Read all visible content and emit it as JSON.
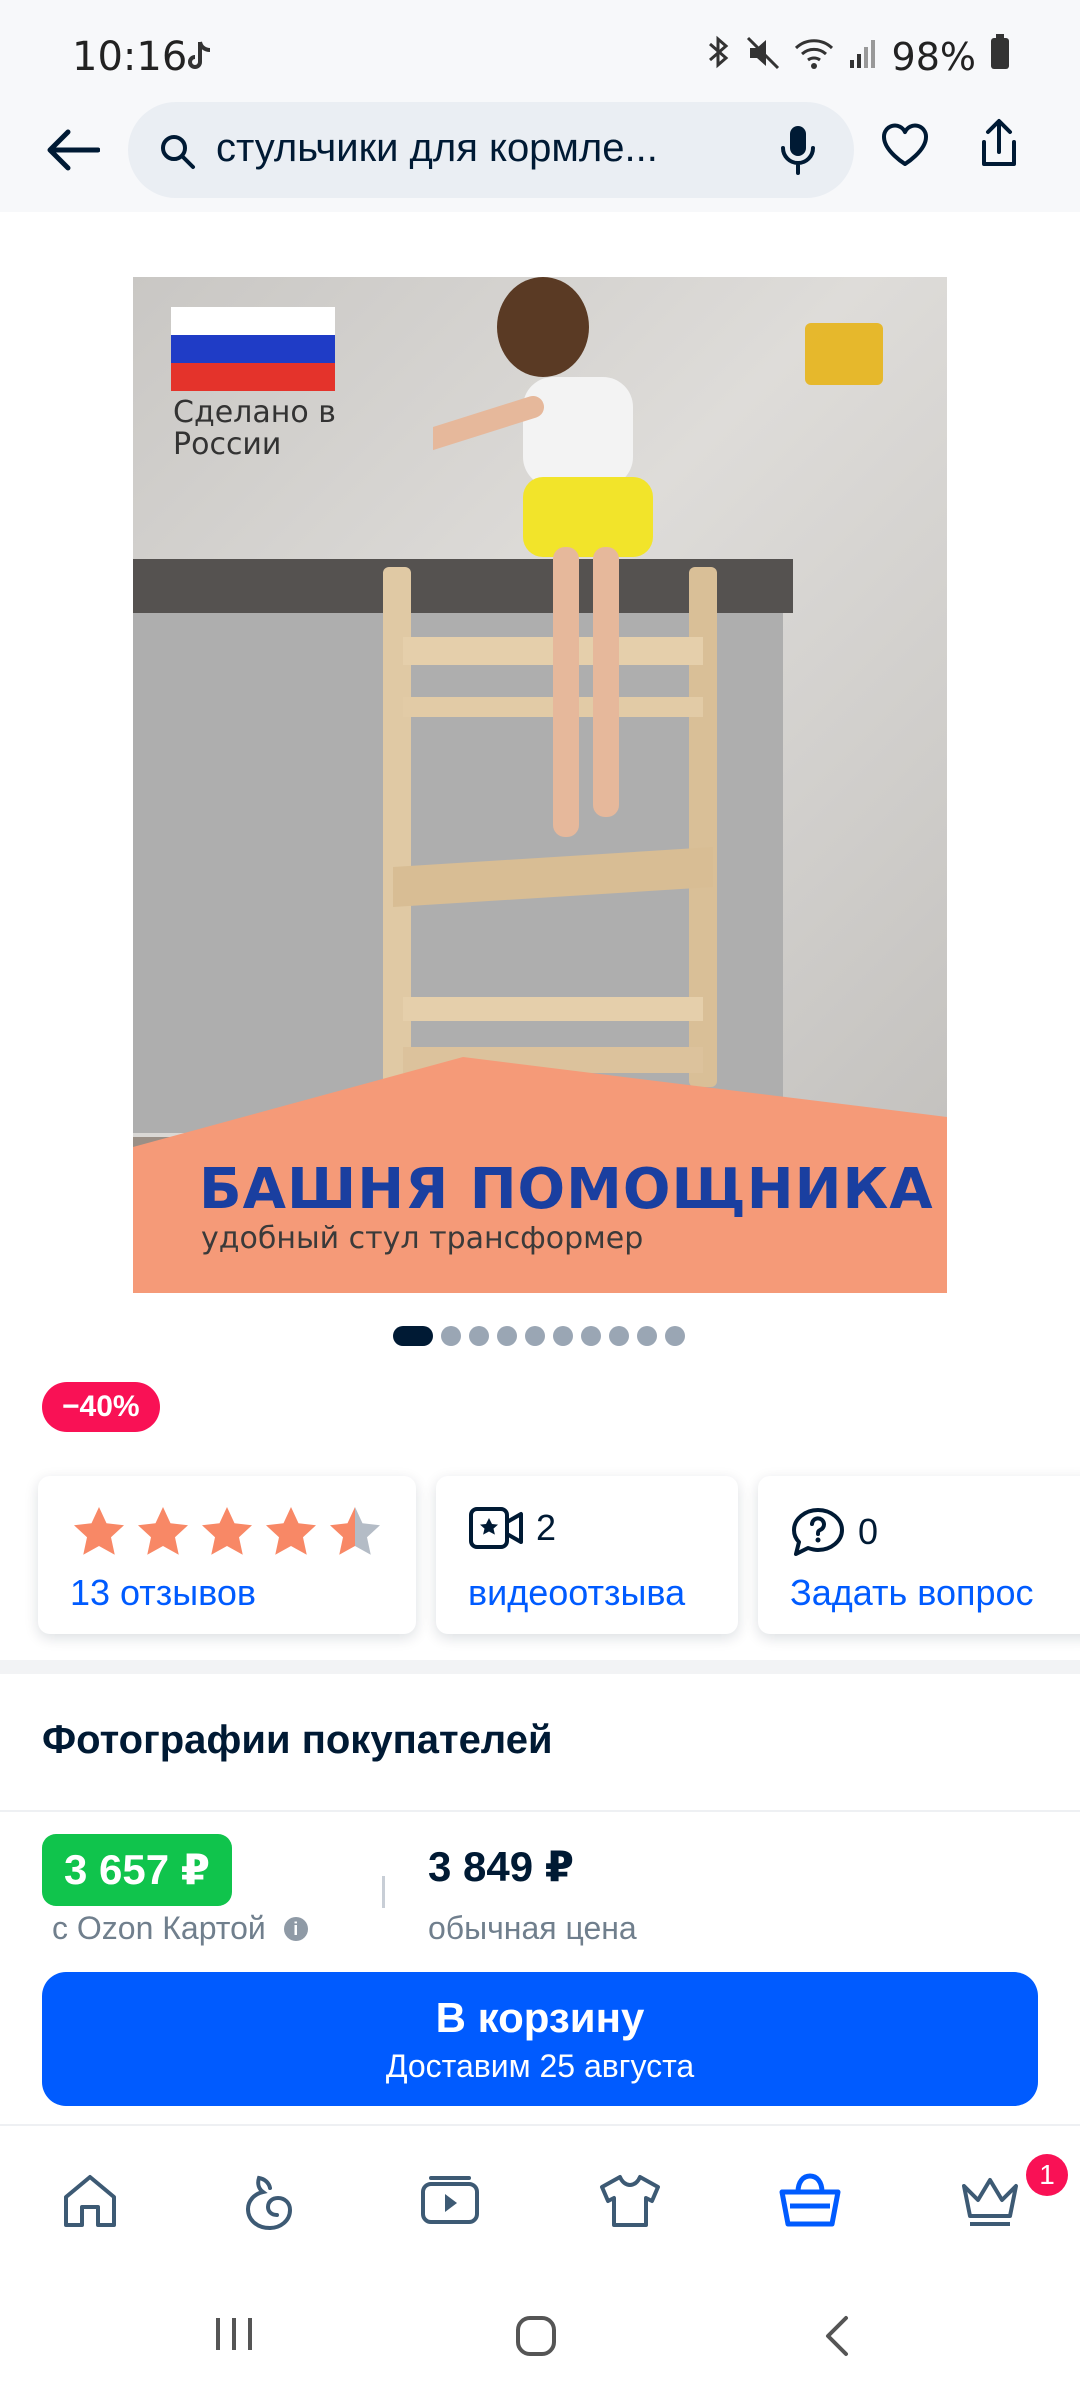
{
  "status_bar": {
    "time": "10:16",
    "battery": "98%",
    "icons": [
      "tiktok-icon",
      "bluetooth-icon",
      "mute-icon",
      "wifi-icon",
      "signal-icon",
      "battery-icon"
    ]
  },
  "header": {
    "search_query": "стульчики для кормле...",
    "icons": [
      "back-arrow-icon",
      "search-icon",
      "mic-icon",
      "heart-icon",
      "share-icon"
    ]
  },
  "product_image": {
    "flag_text": "Сделано в России",
    "banner_title": "БАШНЯ ПОМОЩНИКА",
    "banner_subtitle": "удобный стул трансформер",
    "slide_count": 10,
    "active_slide": 1
  },
  "discount_badge": "−40%",
  "cards": {
    "rating": {
      "stars": 4.5,
      "reviews_link": "13 отзывов"
    },
    "video": {
      "count": "2",
      "link": "видеоотзыва"
    },
    "question": {
      "count": "0",
      "link": "Задать вопрос"
    }
  },
  "customer_photos": {
    "title": "Фотографии покупателей"
  },
  "price": {
    "card_price": "3 657 ₽",
    "card_label": "с Ozon Картой",
    "regular_price": "3 849 ₽",
    "regular_label": "обычная цена"
  },
  "cart_button": {
    "label": "В корзину",
    "delivery": "Доставим 25 августа"
  },
  "bottom_nav": {
    "items": [
      "home-icon",
      "fresh-icon",
      "video-icon",
      "clothes-icon",
      "cart-icon",
      "premium-icon"
    ],
    "active": "cart-icon",
    "badge": "1"
  },
  "colors": {
    "accent": "#005bff",
    "discount": "#f91155",
    "card_price": "#10c44c",
    "star": "#f88866",
    "star_empty": "#b4bcc6",
    "banner": "#f59a78"
  }
}
